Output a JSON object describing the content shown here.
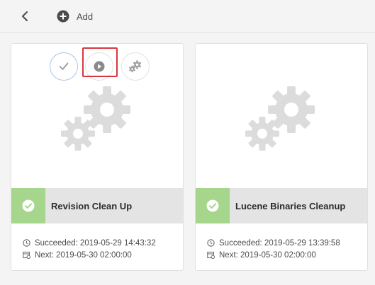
{
  "toolbar": {
    "back_icon": "chevron-left-icon",
    "add_label": "Add",
    "add_icon": "plus-circle-icon"
  },
  "cards": [
    {
      "title": "Revision Clean Up",
      "succeeded": "Succeeded: 2019-05-29 14:43:32",
      "next": "Next: 2019-05-30 02:00:00",
      "status": "success",
      "quick_actions": [
        "checkmark-icon",
        "play-icon",
        "gears-icon"
      ]
    },
    {
      "title": "Lucene Binaries Cleanup",
      "succeeded": "Succeeded: 2019-05-29 13:39:58",
      "next": "Next: 2019-05-30 02:00:00",
      "status": "success"
    }
  ],
  "colors": {
    "success": "#a5d68b",
    "highlight": "#d7373f",
    "gear": "#dcdcdc"
  }
}
